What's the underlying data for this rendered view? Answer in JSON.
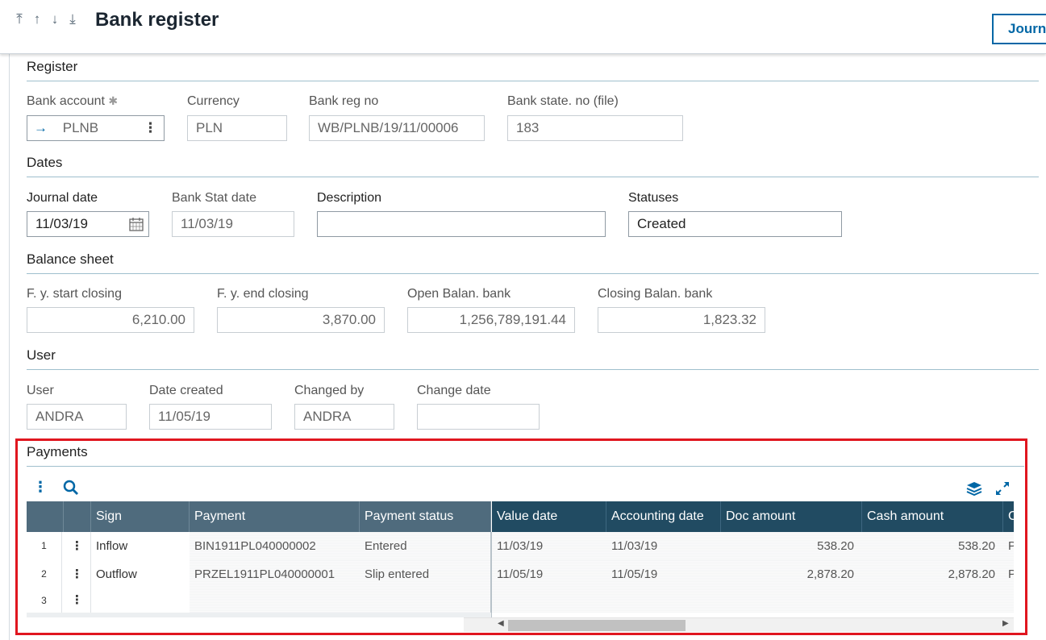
{
  "header": {
    "title": "Bank register",
    "nav": [
      "⤒",
      "↑",
      "↓",
      "⤓"
    ],
    "journal_button": "Journ"
  },
  "register": {
    "section_title": "Register",
    "bank_account": {
      "label": "Bank account",
      "required": "✱",
      "value": "PLNB",
      "arrow": "→",
      "menu": "⋮"
    },
    "currency": {
      "label": "Currency",
      "value": "PLN"
    },
    "bank_reg_no": {
      "label": "Bank reg no",
      "value": "WB/PLNB/19/11/00006"
    },
    "bank_state_no": {
      "label": "Bank state. no (file)",
      "value": "183"
    }
  },
  "dates": {
    "section_title": "Dates",
    "journal_date": {
      "label": "Journal date",
      "value": "11/03/19"
    },
    "bank_stat_date": {
      "label": "Bank Stat date",
      "value": "11/03/19"
    },
    "description": {
      "label": "Description",
      "value": ""
    },
    "statuses": {
      "label": "Statuses",
      "value": "Created"
    }
  },
  "balance": {
    "section_title": "Balance sheet",
    "fy_start": {
      "label": "F. y. start closing",
      "value": "6,210.00"
    },
    "fy_end": {
      "label": "F. y. end closing",
      "value": "3,870.00"
    },
    "open_bank": {
      "label": "Open Balan. bank",
      "value": "1,256,789,191.44"
    },
    "closing_bank": {
      "label": "Closing Balan. bank",
      "value": "1,823.32"
    }
  },
  "user": {
    "section_title": "User",
    "user": {
      "label": "User",
      "value": "ANDRA"
    },
    "date_created": {
      "label": "Date created",
      "value": "11/05/19"
    },
    "changed_by": {
      "label": "Changed by",
      "value": "ANDRA"
    },
    "change_date": {
      "label": "Change date",
      "value": ""
    }
  },
  "payments": {
    "section_title": "Payments",
    "columns_frozen": [
      "Sign",
      "Payment",
      "Payment status"
    ],
    "columns_scroll": [
      "Value date",
      "Accounting date",
      "Doc amount",
      "Cash amount",
      "C"
    ],
    "rows": [
      {
        "num": "1",
        "sign": "Inflow",
        "payment": "BIN1911PL040000002",
        "status": "Entered",
        "value_date": "11/03/19",
        "accounting_date": "11/03/19",
        "doc_amount": "538.20",
        "cash_amount": "538.20",
        "c": "P"
      },
      {
        "num": "2",
        "sign": "Outflow",
        "payment": "PRZEL1911PL040000001",
        "status": "Slip entered",
        "value_date": "11/05/19",
        "accounting_date": "11/05/19",
        "doc_amount": "2,878.20",
        "cash_amount": "2,878.20",
        "c": "P"
      },
      {
        "num": "3",
        "sign": "",
        "payment": "",
        "status": "",
        "value_date": "",
        "accounting_date": "",
        "doc_amount": "",
        "cash_amount": "",
        "c": ""
      }
    ],
    "row_menu": "⋮"
  },
  "colors": {
    "accent": "#0067a6",
    "highlight": "#e0161f",
    "grid_header_frozen": "#4f6b7d",
    "grid_header_scroll": "#214b62"
  }
}
